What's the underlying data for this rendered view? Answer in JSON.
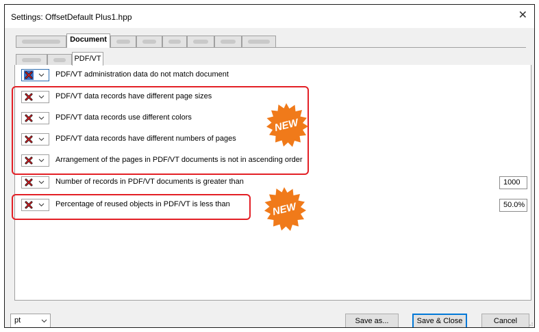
{
  "window": {
    "title": "Settings:  OffsetDefault Plus1.hpp",
    "close_glyph": "✕"
  },
  "tabs": {
    "active_label": "Document",
    "inner_active_label": "PDF/VT"
  },
  "rows": [
    {
      "label": "PDF/VT administration data do not match document"
    },
    {
      "label": "PDF/VT data records have different page sizes"
    },
    {
      "label": "PDF/VT data records use different colors"
    },
    {
      "label": "PDF/VT data records have different numbers of pages"
    },
    {
      "label": "Arrangement of the pages in PDF/VT documents is not in ascending order"
    },
    {
      "label": "Number of records in PDF/VT documents is greater than",
      "value": "1000"
    },
    {
      "label": "Percentage of reused objects in PDF/VT is less than",
      "value": "50.0%"
    }
  ],
  "badges": {
    "new1": "NEW",
    "new2": "NEW"
  },
  "footer": {
    "unit": "pt",
    "save_as": "Save as...",
    "save_close": "Save & Close",
    "cancel": "Cancel"
  },
  "colors": {
    "highlight": "#e31e24",
    "badge": "#f07a1a",
    "selection": "#3d6fc4"
  },
  "icons": {
    "status": "red-x-icon",
    "dropdown": "chevron-down-icon",
    "close": "close-icon"
  }
}
